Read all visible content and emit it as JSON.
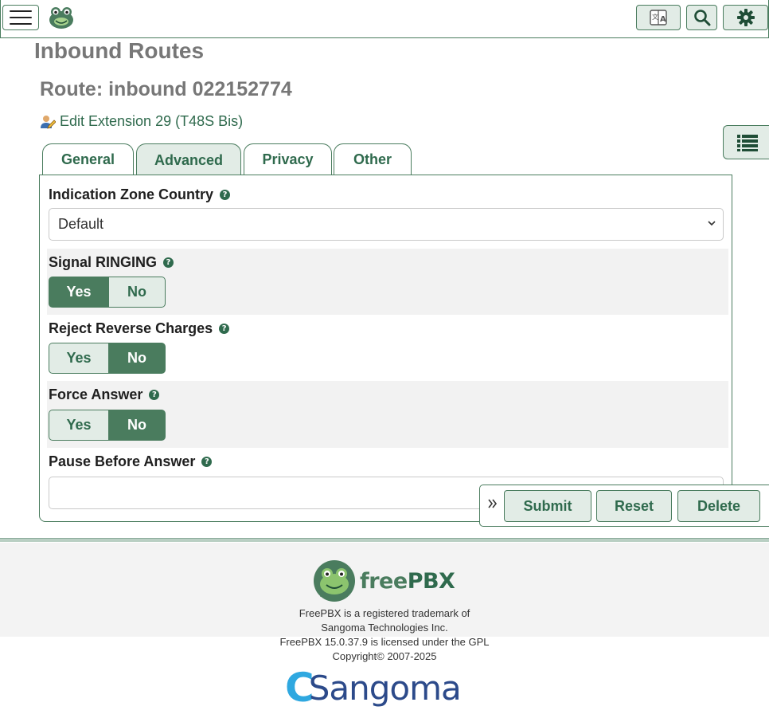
{
  "header": {
    "menu_icon": "hamburger-icon",
    "logo_icon": "frog-logo-icon",
    "language_icon": "language-icon",
    "search_icon": "search-icon",
    "settings_icon": "gear-icon"
  },
  "page": {
    "title": "Inbound Routes",
    "route_title": "Route: inbound 022152774",
    "edit_extension_link": "Edit Extension 29 (T48S Bis)"
  },
  "tabs": [
    {
      "label": "General",
      "active": false
    },
    {
      "label": "Advanced",
      "active": true
    },
    {
      "label": "Privacy",
      "active": false
    },
    {
      "label": "Other",
      "active": false
    }
  ],
  "form": {
    "indication_zone": {
      "label": "Indication Zone Country",
      "value": "Default"
    },
    "signal_ringing": {
      "label": "Signal RINGING",
      "yes": "Yes",
      "no": "No",
      "selected": "Yes"
    },
    "reject_reverse_charges": {
      "label": "Reject Reverse Charges",
      "yes": "Yes",
      "no": "No",
      "selected": "No"
    },
    "force_answer": {
      "label": "Force Answer",
      "yes": "Yes",
      "no": "No",
      "selected": "No"
    },
    "pause_before_answer": {
      "label": "Pause Before Answer",
      "value": ""
    },
    "help_glyph": "?"
  },
  "actions": {
    "submit": "Submit",
    "reset": "Reset",
    "delete": "Delete"
  },
  "footer": {
    "brand_free": "free",
    "brand_pbx": "PBX",
    "trademark_line1": "FreePBX is a registered trademark of",
    "trademark_line2": "Sangoma Technologies Inc.",
    "license": "FreePBX 15.0.37.9 is licensed under the GPL",
    "copyright": "Copyright© 2007-2025",
    "sangoma_c": "C",
    "sangoma_rest": "Sangoma"
  },
  "colors": {
    "accent": "#4a7c5e",
    "accent_light": "#e2ece6",
    "link": "#2f6a4d",
    "sangoma_blue": "#2c4a8a",
    "sangoma_cyan": "#2fa8e0"
  }
}
